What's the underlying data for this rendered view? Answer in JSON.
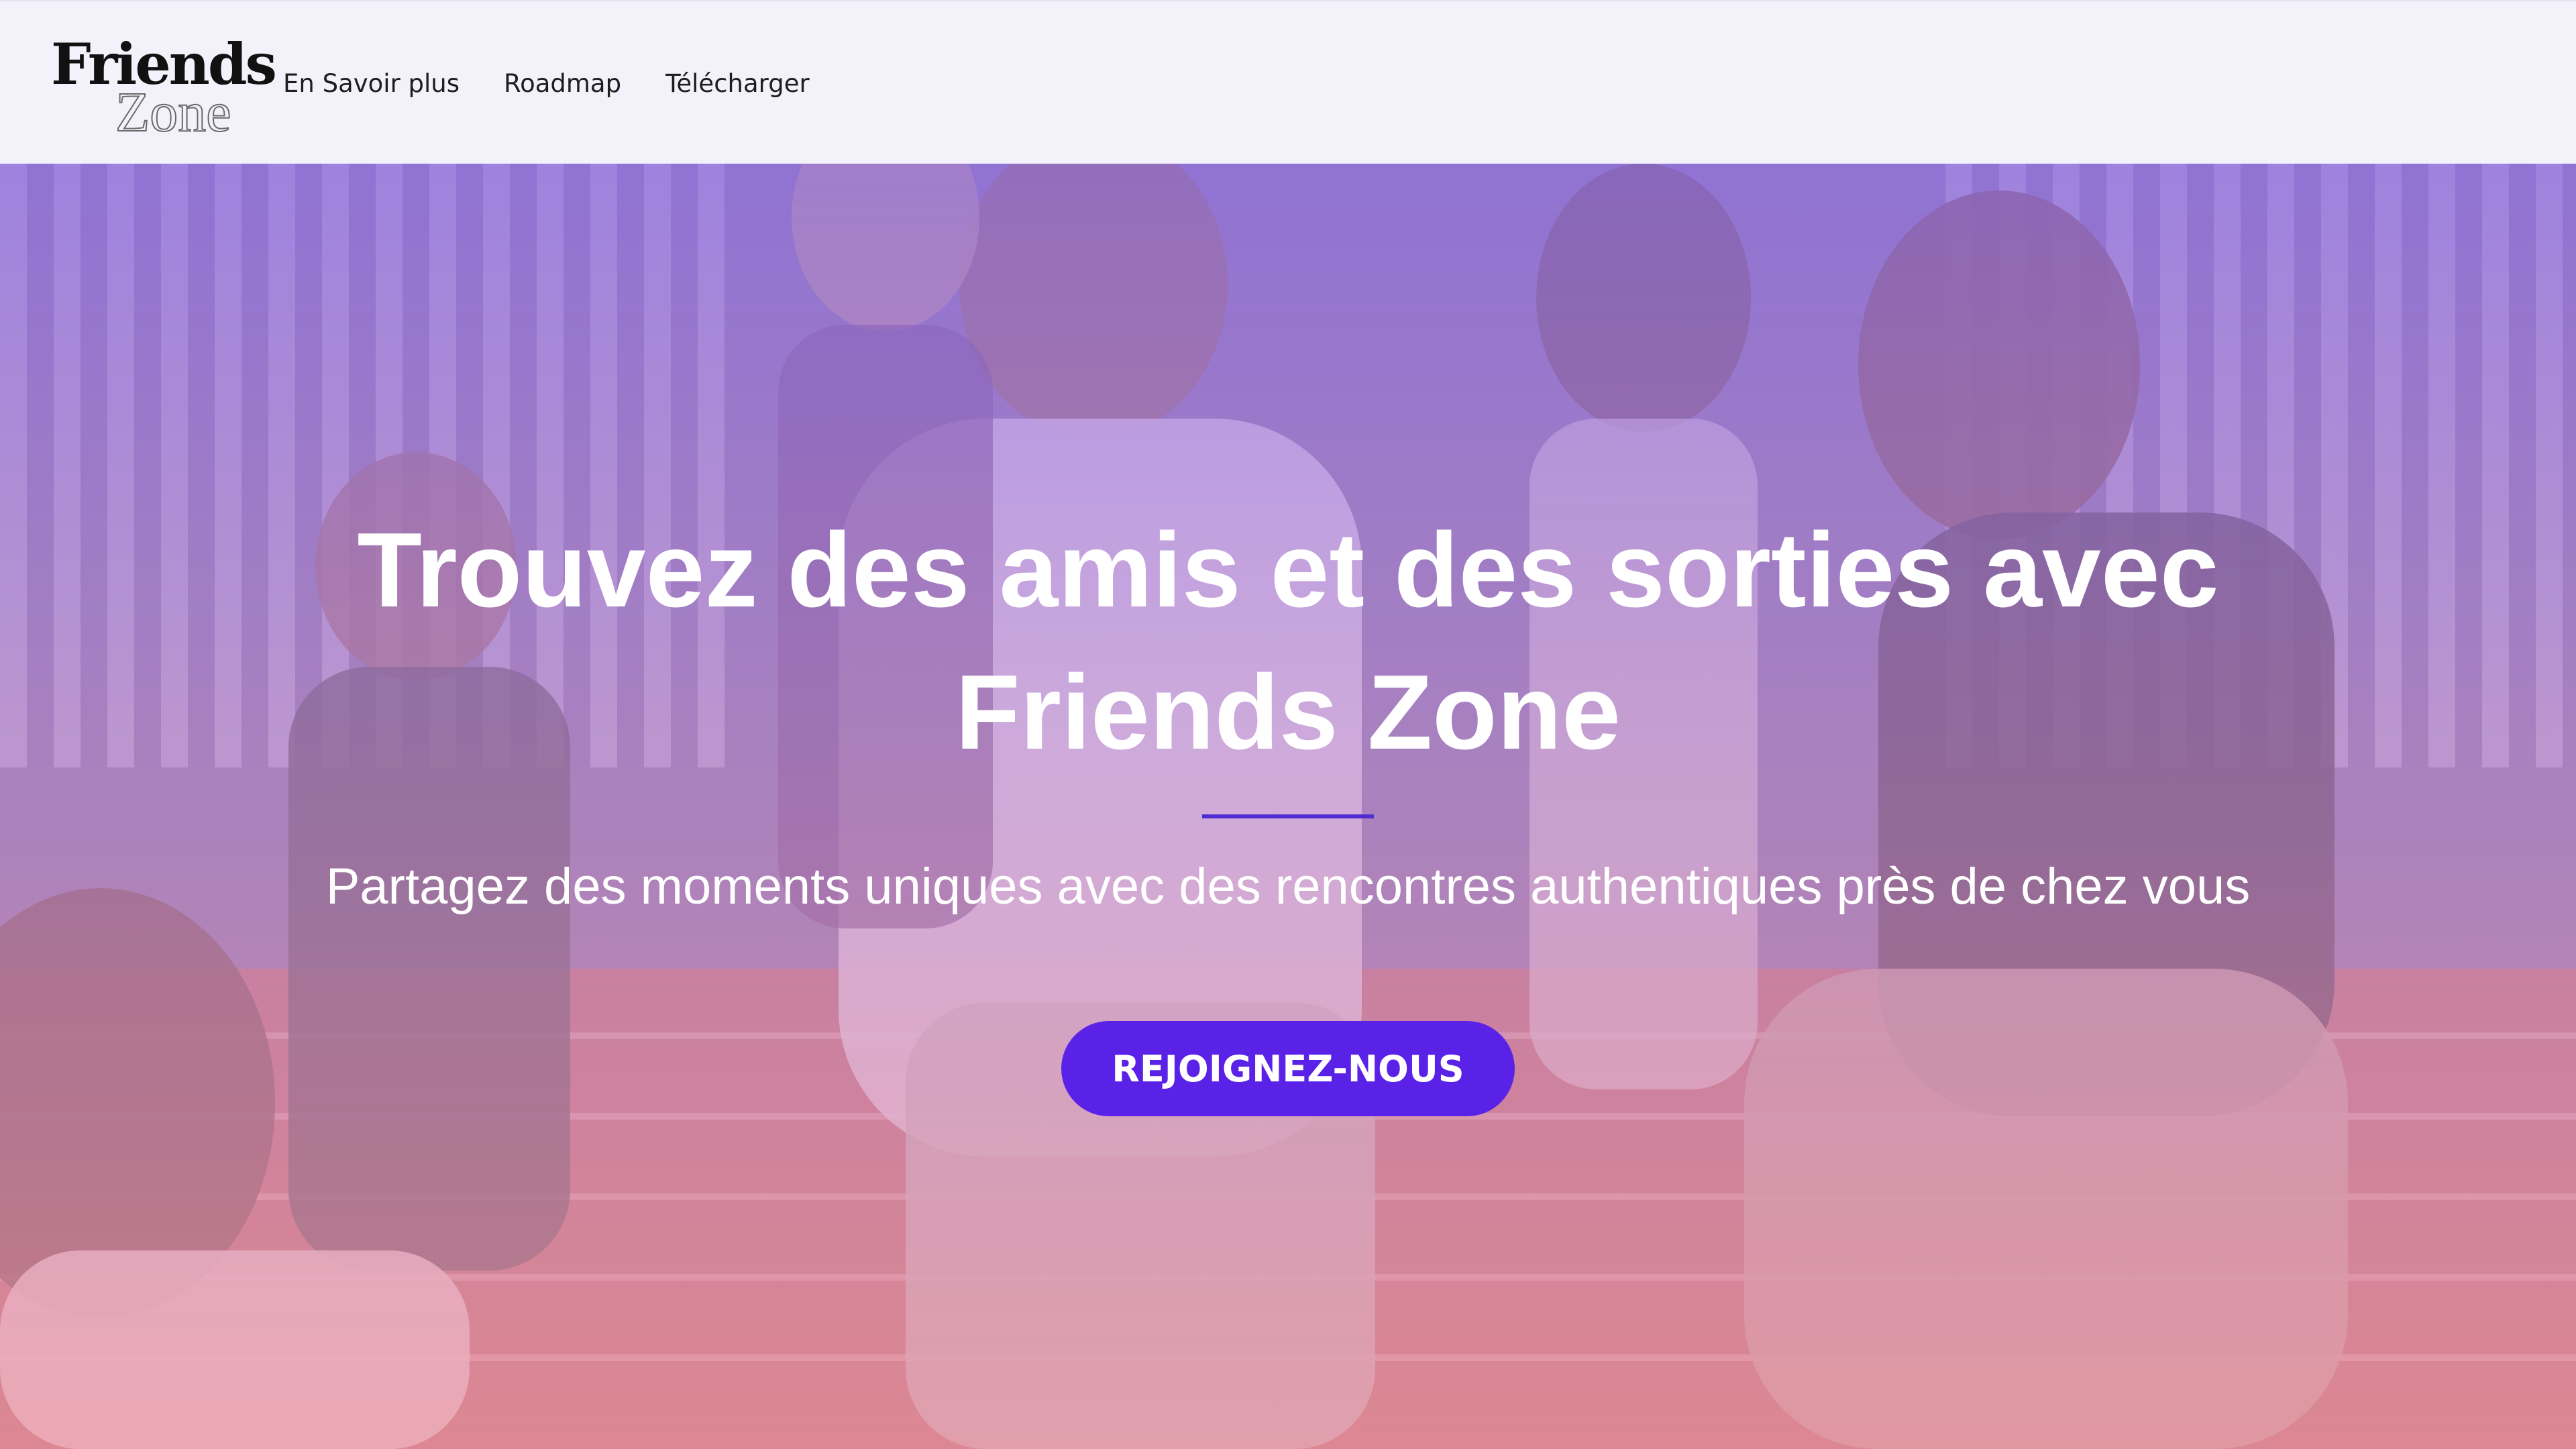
{
  "header": {
    "logo": {
      "line1": "Friends",
      "line2": "Zone"
    },
    "nav": {
      "items": [
        {
          "label": "En Savoir plus"
        },
        {
          "label": "Roadmap"
        },
        {
          "label": "Télécharger"
        }
      ]
    }
  },
  "hero": {
    "title": "Trouvez des amis et des sorties avec Friends Zone",
    "subtitle": "Partagez des moments uniques avec des rencontres authentiques près de chez vous",
    "cta_label": "REJOIGNEZ-NOUS",
    "image_icon": "group-of-friends-photo"
  },
  "colors": {
    "accent": "#5a22e6",
    "divider": "#4f2dd4",
    "header_bg": "#f3f1fa",
    "overlay_top": "#9874e8",
    "overlay_bottom": "#ec96aa"
  }
}
